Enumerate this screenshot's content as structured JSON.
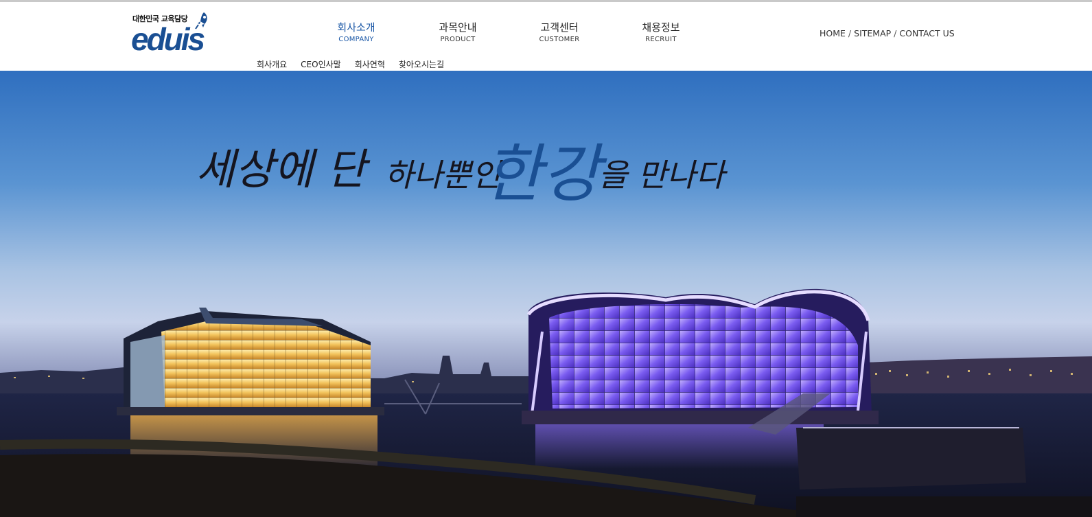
{
  "header": {
    "logo_tagline": "대한민국 교육담당",
    "logo_text": "eduis",
    "util_links": [
      "HOME",
      "SITEMAP",
      "CONTACT US"
    ],
    "util_separator": "/"
  },
  "gnb": [
    {
      "ko": "회사소개",
      "en": "COMPANY",
      "active": true
    },
    {
      "ko": "과목안내",
      "en": "PRODUCT",
      "active": false
    },
    {
      "ko": "고객센터",
      "en": "CUSTOMER",
      "active": false
    },
    {
      "ko": "채용정보",
      "en": "RECRUIT",
      "active": false
    }
  ],
  "subnav": [
    "회사개요",
    "CEO인사말",
    "회사연혁",
    "찾아오시는길"
  ],
  "hero": {
    "slogan_parts": [
      "세상에 단",
      "하나뿐인",
      "한강",
      "을 만나다"
    ]
  },
  "colors": {
    "brand": "#1a4f93",
    "active_menu": "#1a57a6",
    "sky_top": "#2f6fbf",
    "building_gold": "#f2c25a",
    "building_violet": "#7a5cf0"
  }
}
